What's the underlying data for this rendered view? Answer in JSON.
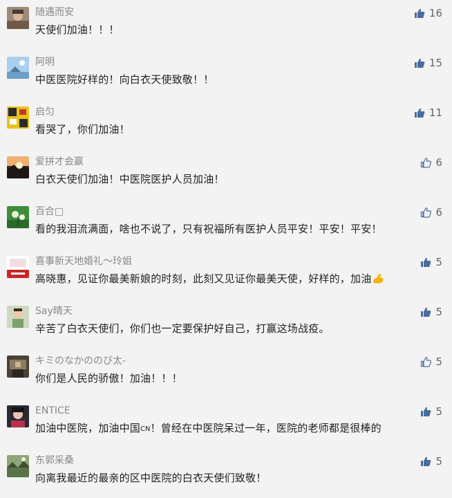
{
  "comments": [
    {
      "nickname": "随遇而安",
      "content": "天使们加油！！！",
      "likes": "16",
      "liked": false,
      "avatar": "avatar-elderly-woman"
    },
    {
      "nickname": "阿明",
      "content": "中医医院好样的！向白衣天使致敬！！",
      "likes": "15",
      "liked": false,
      "avatar": "avatar-blue-sky"
    },
    {
      "nickname": "启匀",
      "content": "看哭了，你们加油！",
      "likes": "11",
      "liked": false,
      "avatar": "avatar-yellow-pattern"
    },
    {
      "nickname": "爱拼才会赢",
      "content": "白衣天使们加油！中医院医护人员加油！",
      "likes": "6",
      "liked": true,
      "avatar": "avatar-sunset"
    },
    {
      "nickname": "百合□",
      "content": "看的我泪流满面，啥也不说了，只有祝福所有医护人员平安！平安！平安！",
      "likes": "6",
      "liked": true,
      "avatar": "avatar-green-lily"
    },
    {
      "nickname": "喜事新天地婚礼～玲姐",
      "content": "高晓惠，见证你最美新娘的时刻，此刻又见证你最美天使，好样的，加油",
      "content_emoji": "flexed-biceps-icon",
      "likes": "5",
      "liked": false,
      "avatar": "avatar-wedding-logo"
    },
    {
      "nickname": "Say晴天",
      "content": "辛苦了白衣天使们，你们也一定要保护好自己，打赢这场战疫。",
      "likes": "5",
      "liked": false,
      "avatar": "avatar-child-photo"
    },
    {
      "nickname": "キミのなかののび太-",
      "content": "你们是人民的骄傲！加油！！！",
      "likes": "5",
      "liked": true,
      "avatar": "avatar-dark-photo"
    },
    {
      "nickname": "ENTICE",
      "content": "加油中医院，加油中国🇨🇳！曾经在中医院呆过一年，医院的老师都是很棒的",
      "content_prefix": "加油中医院，加油中国",
      "content_flag": "CN",
      "content_suffix": "！曾经在中医院呆过一年，医院的老师都是很棒的",
      "likes": "5",
      "liked": false,
      "avatar": "avatar-portrait"
    },
    {
      "nickname": "东郭采桑",
      "content": "向离我最近的最亲的区中医院的白衣天使们致敬！",
      "likes": "5",
      "liked": false,
      "avatar": "avatar-landscape"
    }
  ],
  "colors": {
    "background": "#f3f3f3",
    "nickname": "#888888",
    "content": "#222222",
    "like_icon": "#4a6d9c",
    "like_count": "#666666"
  }
}
